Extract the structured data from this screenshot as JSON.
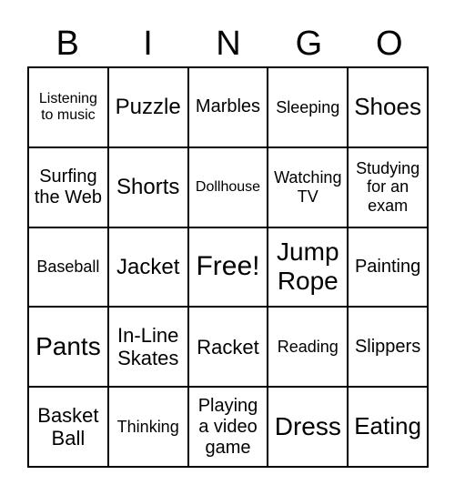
{
  "header": {
    "letters": [
      "B",
      "I",
      "N",
      "G",
      "O"
    ]
  },
  "cells": [
    "Listening to music",
    "Puzzle",
    "Marbles",
    "Sleeping",
    "Shoes",
    "Surfing the Web",
    "Shorts",
    "Dollhouse",
    "Watching TV",
    "Studying for an exam",
    "Baseball",
    "Jacket",
    "Free!",
    "Jump Rope",
    "Painting",
    "Pants",
    "In-Line Skates",
    "Racket",
    "Reading",
    "Slippers",
    "Basket Ball",
    "Thinking",
    "Playing a video game",
    "Dress",
    "Eating"
  ]
}
